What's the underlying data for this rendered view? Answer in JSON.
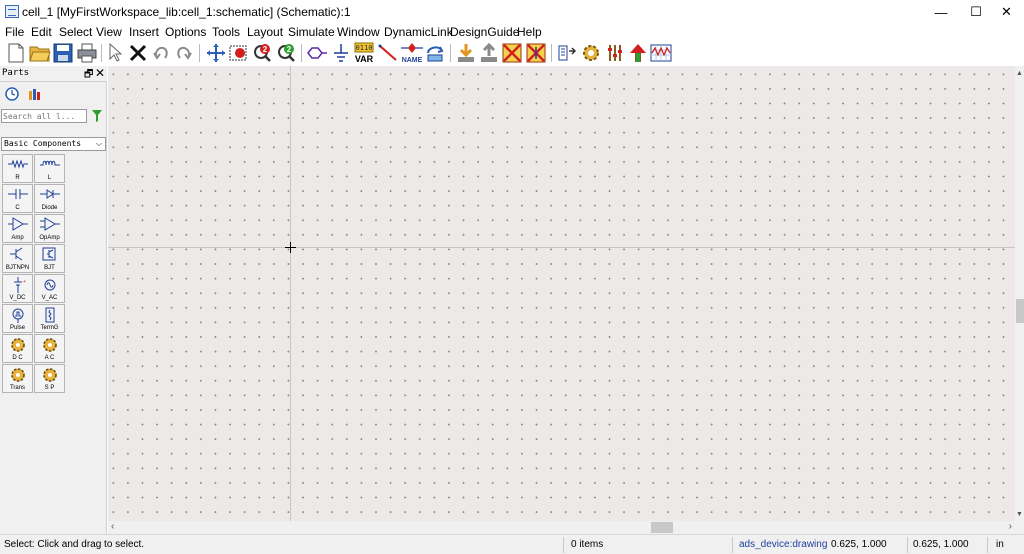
{
  "window": {
    "title": "cell_1 [MyFirstWorkspace_lib:cell_1:schematic] (Schematic):1",
    "minimize": "—",
    "maximize": "☐",
    "close": "✕"
  },
  "menu": [
    "File",
    "Edit",
    "Select",
    "View",
    "Insert",
    "Options",
    "Tools",
    "Layout",
    "Simulate",
    "Window",
    "DynamicLink",
    "DesignGuide",
    "Help"
  ],
  "toolbar": {
    "var_label": "VAR",
    "var_bits": "0110",
    "name_label": "NAME"
  },
  "parts": {
    "title": "Parts",
    "float_glyph": "🗗",
    "close_glyph": "✕",
    "search_placeholder": "Search all l...",
    "library": "Basic Components",
    "library_arrow": "⌵",
    "items": [
      {
        "label": "R"
      },
      {
        "label": "L"
      },
      {
        "label": "C"
      },
      {
        "label": "Diode"
      },
      {
        "label": "Amp"
      },
      {
        "label": "OpAmp"
      },
      {
        "label": "BJTNPN"
      },
      {
        "label": "BJT"
      },
      {
        "label": "V_DC"
      },
      {
        "label": "V_AC"
      },
      {
        "label": "Pulse"
      },
      {
        "label": "TermG"
      },
      {
        "label": "D C"
      },
      {
        "label": "A C"
      },
      {
        "label": "Trans"
      },
      {
        "label": "S P"
      }
    ]
  },
  "statusbar": {
    "message": "Select: Click and drag to select.",
    "items": "0 items",
    "layer": "ads_device:drawing",
    "coord1": "0.625, 1.000",
    "coord2": "0.625, 1.000",
    "units": "in"
  },
  "colors": {
    "canvas_bg": "#ede9e8",
    "layer_text": "#1f3f9a",
    "accent_red": "#d22020",
    "accent_green": "#2e9e2e"
  }
}
